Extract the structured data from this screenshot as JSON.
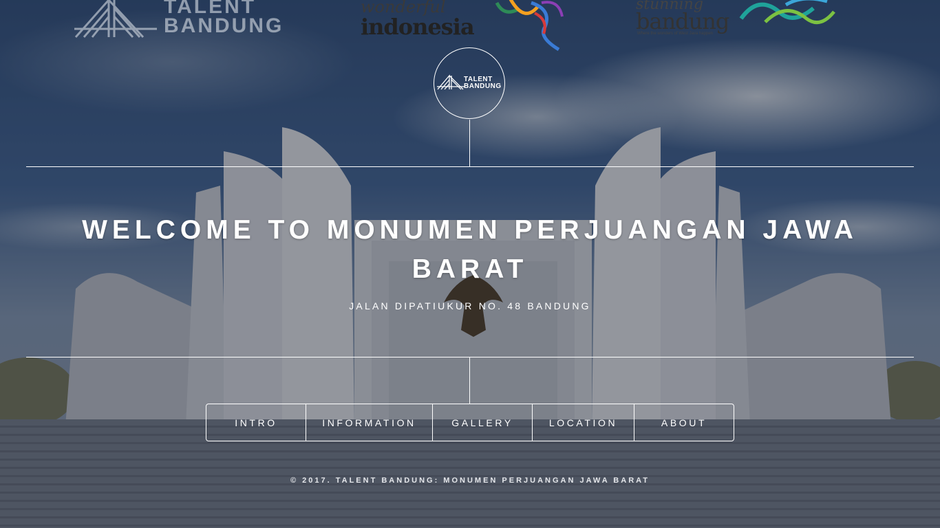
{
  "partners": {
    "talent_name_line1": "TALENT",
    "talent_name_line2": "BANDUNG",
    "wonderful_line1": "wonderful",
    "wonderful_line2": "indonesia",
    "stunning_line1": "stunning",
    "stunning_line2": "bandung",
    "stunning_tagline": "Where the wonders of West Java happen"
  },
  "emblem": {
    "line1": "TALENT",
    "line2": "BANDUNG"
  },
  "hero": {
    "title": "WELCOME TO MONUMEN PERJUANGAN JAWA BARAT",
    "address": "Jalan Dipatiukur No. 48 Bandung"
  },
  "nav": {
    "items": [
      {
        "label": "INTRO"
      },
      {
        "label": "INFORMATION"
      },
      {
        "label": "GALLERY"
      },
      {
        "label": "LOCATION"
      },
      {
        "label": "ABOUT"
      }
    ]
  },
  "footer": {
    "text": "© 2017. TALENT BANDUNG: MONUMEN PERJUANGAN JAWA BARAT"
  }
}
